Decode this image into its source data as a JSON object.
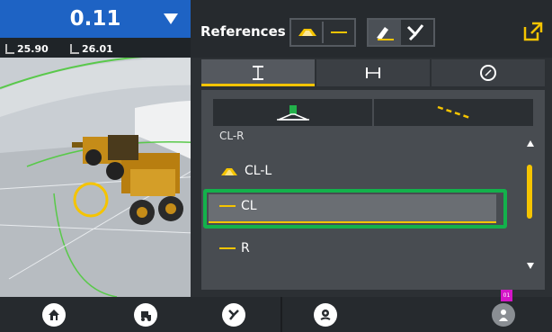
{
  "readout": {
    "main_value": "0.11",
    "left_value": "25.90",
    "right_value": "26.01"
  },
  "panel": {
    "title": "References",
    "tabs": [
      {
        "name": "vertical",
        "icon": "vertical-extent-icon",
        "active": true
      },
      {
        "name": "horizontal",
        "icon": "horizontal-extent-icon",
        "active": false
      },
      {
        "name": "compass",
        "icon": "compass-icon",
        "active": false
      }
    ],
    "mode_buttons": [
      {
        "name": "surface",
        "icon": "surface-reference-icon"
      },
      {
        "name": "line",
        "icon": "dashed-line-icon"
      }
    ],
    "list": {
      "partial_label": "CL-R",
      "items": [
        {
          "label": "CL-L",
          "icon": "road-profile-icon"
        },
        {
          "label": "CL",
          "icon": "line-dash-icon",
          "selected": true
        },
        {
          "label": "R",
          "icon": "line-dash-icon"
        }
      ]
    }
  },
  "bottom_bar": {
    "buttons": [
      "home-icon",
      "machine-icon",
      "tool-icon",
      "location-icon",
      "operator-icon"
    ],
    "badge_text": "01"
  },
  "colors": {
    "accent_blue": "#1e63c4",
    "accent_yellow": "#f5c400",
    "selection_green": "#13b14b"
  }
}
